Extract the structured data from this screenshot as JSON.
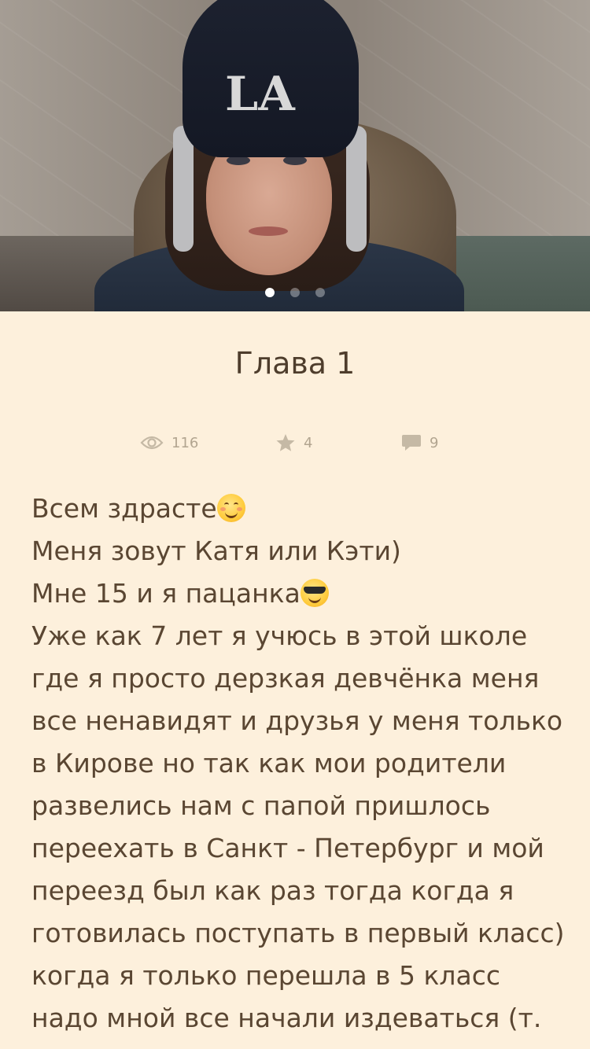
{
  "gallery": {
    "slide_count": 3,
    "active_slide": 1,
    "hat_logo": "LA"
  },
  "chapter": {
    "title": "Глава 1"
  },
  "stats": {
    "views": "116",
    "stars": "4",
    "comments": "9",
    "icon_color": "#b2a590"
  },
  "story": {
    "lines": [
      "Всем здрасте",
      "Меня зовут Катя или Кэти)",
      "Мне 15 и я пацанка",
      "Уже как 7 лет я учюсь в этой школе",
      "где я просто дерзкая девчёнка меня",
      "все ненавидят и друзья у меня только",
      "в Кирове но так как мои родители",
      "развелись нам с папой пришлось",
      "переехать в Санкт - Петербург и мой",
      "переезд был как раз тогда когда я",
      "готовилась поступать в первый класс)",
      "когда я только перешла в 5 класс",
      "надо мной все начали издеваться (т."
    ],
    "emojis": [
      "smiling-face-emoji",
      "sunglasses-face-emoji"
    ]
  },
  "colors": {
    "background": "#fdf0dc",
    "text": "#5a4632",
    "title": "#4e3d2c"
  }
}
